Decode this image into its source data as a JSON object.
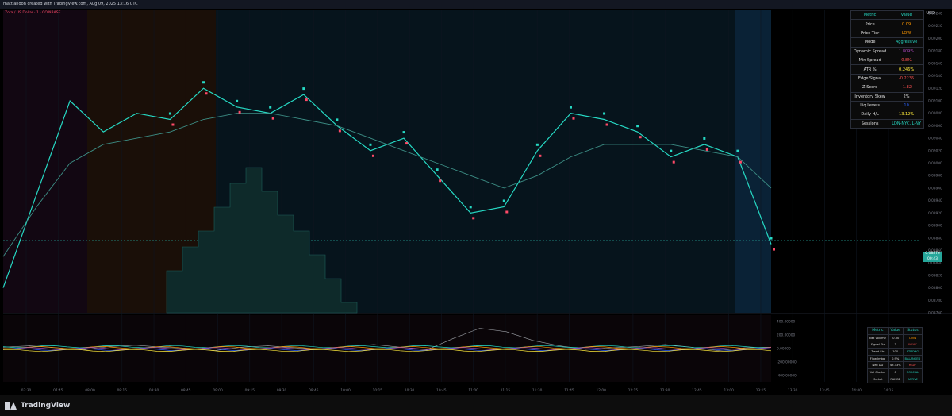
{
  "header_text": "mattlandon created with TradingView.com, Aug 09, 2025 13:16 UTC",
  "symbol_text": "Zora / US Dollar · 1 · COINBASE",
  "currency": "USD",
  "brand": "TradingView",
  "last_price_tag": {
    "price": "0.08876",
    "sub": "00:43"
  },
  "metrics_table": {
    "headers": [
      "Metric",
      "Value"
    ],
    "rows": [
      {
        "metric": "Price",
        "value": "0.09",
        "color": "#ff9800"
      },
      {
        "metric": "Price Tier",
        "value": "LOW",
        "color": "#ff9800"
      },
      {
        "metric": "Mode",
        "value": "Aggressive",
        "color": "#26d9c4"
      },
      {
        "metric": "Dynamic Spread",
        "value": "1.809%",
        "color": "#ab47bc"
      },
      {
        "metric": "Min Spread",
        "value": "0.8%",
        "color": "#ff5252"
      },
      {
        "metric": "ATR %",
        "value": "0.246%",
        "color": "#ffeb3b"
      },
      {
        "metric": "Edge Signal",
        "value": "-0.2235",
        "color": "#ff5252"
      },
      {
        "metric": "Z-Score",
        "value": "-1.82",
        "color": "#ff5252"
      },
      {
        "metric": "Inventory Skew",
        "value": "2%",
        "color": "#e0e0e0"
      },
      {
        "metric": "Liq Levels",
        "value": "10",
        "color": "#2962ff"
      },
      {
        "metric": "Daily H/L",
        "value": "13.12%",
        "color": "#ffeb3b"
      },
      {
        "metric": "Sessions",
        "value": "LDN-NYC, L-NY",
        "color": "#26d9c4"
      }
    ]
  },
  "status_table": {
    "headers": [
      "Metric",
      "Value",
      "Status"
    ],
    "rows": [
      {
        "metric": "Net Volume",
        "value": "-0.00",
        "status": "LOW",
        "color": "#ff9800"
      },
      {
        "metric": "Signal Str",
        "value": "3",
        "status": "WEAK",
        "color": "#ff5252"
      },
      {
        "metric": "Trend Str",
        "value": "100",
        "status": "STRONG",
        "color": "#26d9c4"
      },
      {
        "metric": "Flow Imbal",
        "value": "0.9%",
        "status": "BALANCED",
        "color": "#26d9c4"
      },
      {
        "metric": "Neo DD",
        "value": "49.33%",
        "status": "HIGH",
        "color": "#ff5252"
      },
      {
        "metric": "Vol Cluster",
        "value": "0",
        "status": "NORMAL",
        "color": "#26d9c4"
      },
      {
        "metric": "Market",
        "value": "RANGE",
        "status": "ACTIVE",
        "color": "#26d9c4"
      }
    ]
  },
  "chart_data": [
    {
      "type": "line",
      "x": [
        "07:30",
        "07:45",
        "08:00",
        "08:15",
        "08:30",
        "08:45",
        "09:00",
        "09:15",
        "09:30",
        "09:45",
        "10:00",
        "10:15",
        "10:30",
        "10:45",
        "11:00",
        "11:15",
        "11:30",
        "11:45",
        "12:00",
        "12:15",
        "12:30",
        "12:45",
        "13:00",
        "13:15",
        "13:30",
        "13:45",
        "14:00",
        "14:15"
      ],
      "y_ticks": [
        "0.09240",
        "0.09220",
        "0.09200",
        "0.09180",
        "0.09160",
        "0.09140",
        "0.09120",
        "0.09100",
        "0.09080",
        "0.09060",
        "0.09040",
        "0.09020",
        "0.09000",
        "0.08980",
        "0.08960",
        "0.08940",
        "0.08920",
        "0.08900",
        "0.08880",
        "0.08860",
        "0.08840",
        "0.08820",
        "0.08800",
        "0.08780",
        "0.08760"
      ],
      "ylim": [
        0.0876,
        0.0924
      ],
      "last_price": 0.08876,
      "series": [
        {
          "values": [
            0.088,
            0.0895,
            0.091,
            0.0905,
            0.0908,
            0.0907,
            0.0912,
            0.0909,
            0.0908,
            0.0911,
            0.0906,
            0.0902,
            0.0904,
            0.0898,
            0.0892,
            0.0893,
            0.0902,
            0.0908,
            0.0907,
            0.0905,
            0.0901,
            0.0903,
            0.0901,
            0.0887
          ],
          "color": "#26d9c4"
        },
        {
          "values": [
            0.0885,
            0.0893,
            0.09,
            0.0903,
            0.0904,
            0.0905,
            0.0907,
            0.0908,
            0.0908,
            0.0907,
            0.0906,
            0.0904,
            0.0902,
            0.09,
            0.0898,
            0.0896,
            0.0898,
            0.0901,
            0.0903,
            0.0903,
            0.0903,
            0.0902,
            0.0901,
            0.0896
          ],
          "color": "#3d8f86"
        }
      ]
    },
    {
      "type": "line",
      "y_ticks": [
        "400.00000",
        "200.00000",
        "0.00000",
        "-200.00000",
        "-400.00000"
      ],
      "ylim": [
        -400,
        400
      ],
      "values": [
        20,
        40,
        10,
        -20,
        30,
        50,
        20,
        0,
        -30,
        20,
        40,
        10,
        -10,
        30,
        60,
        20,
        -20,
        150,
        300,
        250,
        120,
        40,
        -10,
        10,
        30,
        60,
        20,
        -30,
        10,
        20
      ]
    }
  ]
}
